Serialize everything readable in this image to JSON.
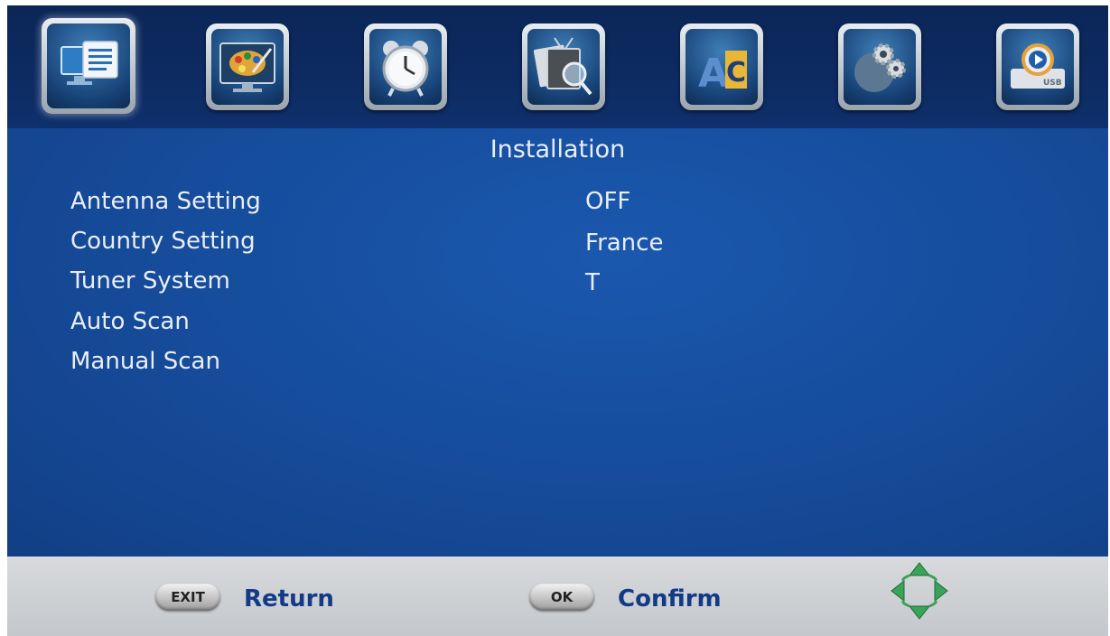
{
  "top_menu": {
    "icons": [
      {
        "name": "installation-icon",
        "selected": true
      },
      {
        "name": "picture-icon",
        "selected": false
      },
      {
        "name": "timer-clock-icon",
        "selected": false
      },
      {
        "name": "channel-search-icon",
        "selected": false
      },
      {
        "name": "language-icon",
        "selected": false
      },
      {
        "name": "settings-gears-icon",
        "selected": false
      },
      {
        "name": "usb-media-icon",
        "selected": false
      }
    ],
    "usb_text": "USB"
  },
  "panel": {
    "title": "Installation",
    "items": [
      {
        "label": "Antenna Setting",
        "value": "OFF"
      },
      {
        "label": "Country Setting",
        "value": "France"
      },
      {
        "label": "Tuner System",
        "value": "T"
      },
      {
        "label": "Auto Scan",
        "value": ""
      },
      {
        "label": "Manual Scan",
        "value": ""
      }
    ]
  },
  "footer": {
    "exit_key": "EXIT",
    "exit_label": "Return",
    "ok_key": "OK",
    "ok_label": "Confirm",
    "nav_icon": "direction-arrows-icon"
  },
  "colors": {
    "header_bg": "#0d2b63",
    "panel_bg": "#154a98",
    "footer_bg": "#d0d2d5",
    "footer_text": "#123a86",
    "arrow_green": "#3aa35a"
  }
}
